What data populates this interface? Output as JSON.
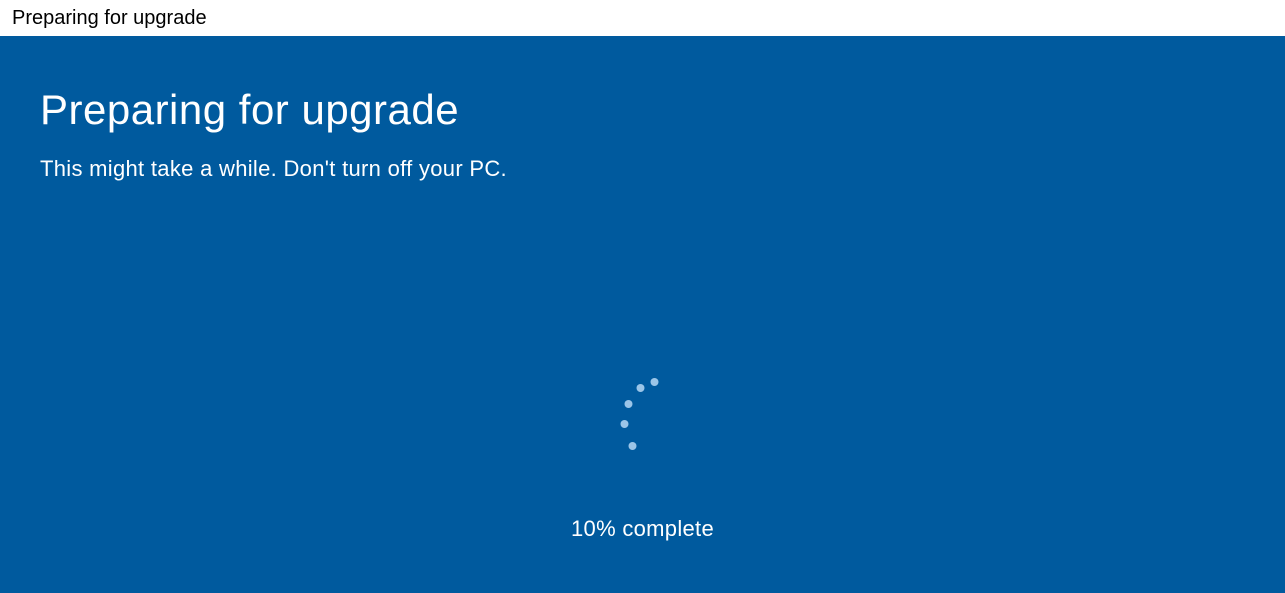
{
  "window": {
    "title": "Preparing for upgrade"
  },
  "main": {
    "heading": "Preparing for upgrade",
    "subtitle": "This might take a while. Don't turn off your PC.",
    "progress_text": "10% complete",
    "progress_percent": 10
  },
  "colors": {
    "panel_bg": "#005a9e",
    "text": "#ffffff",
    "title_text": "#000000",
    "spinner_dot": "#9bc5e8"
  }
}
